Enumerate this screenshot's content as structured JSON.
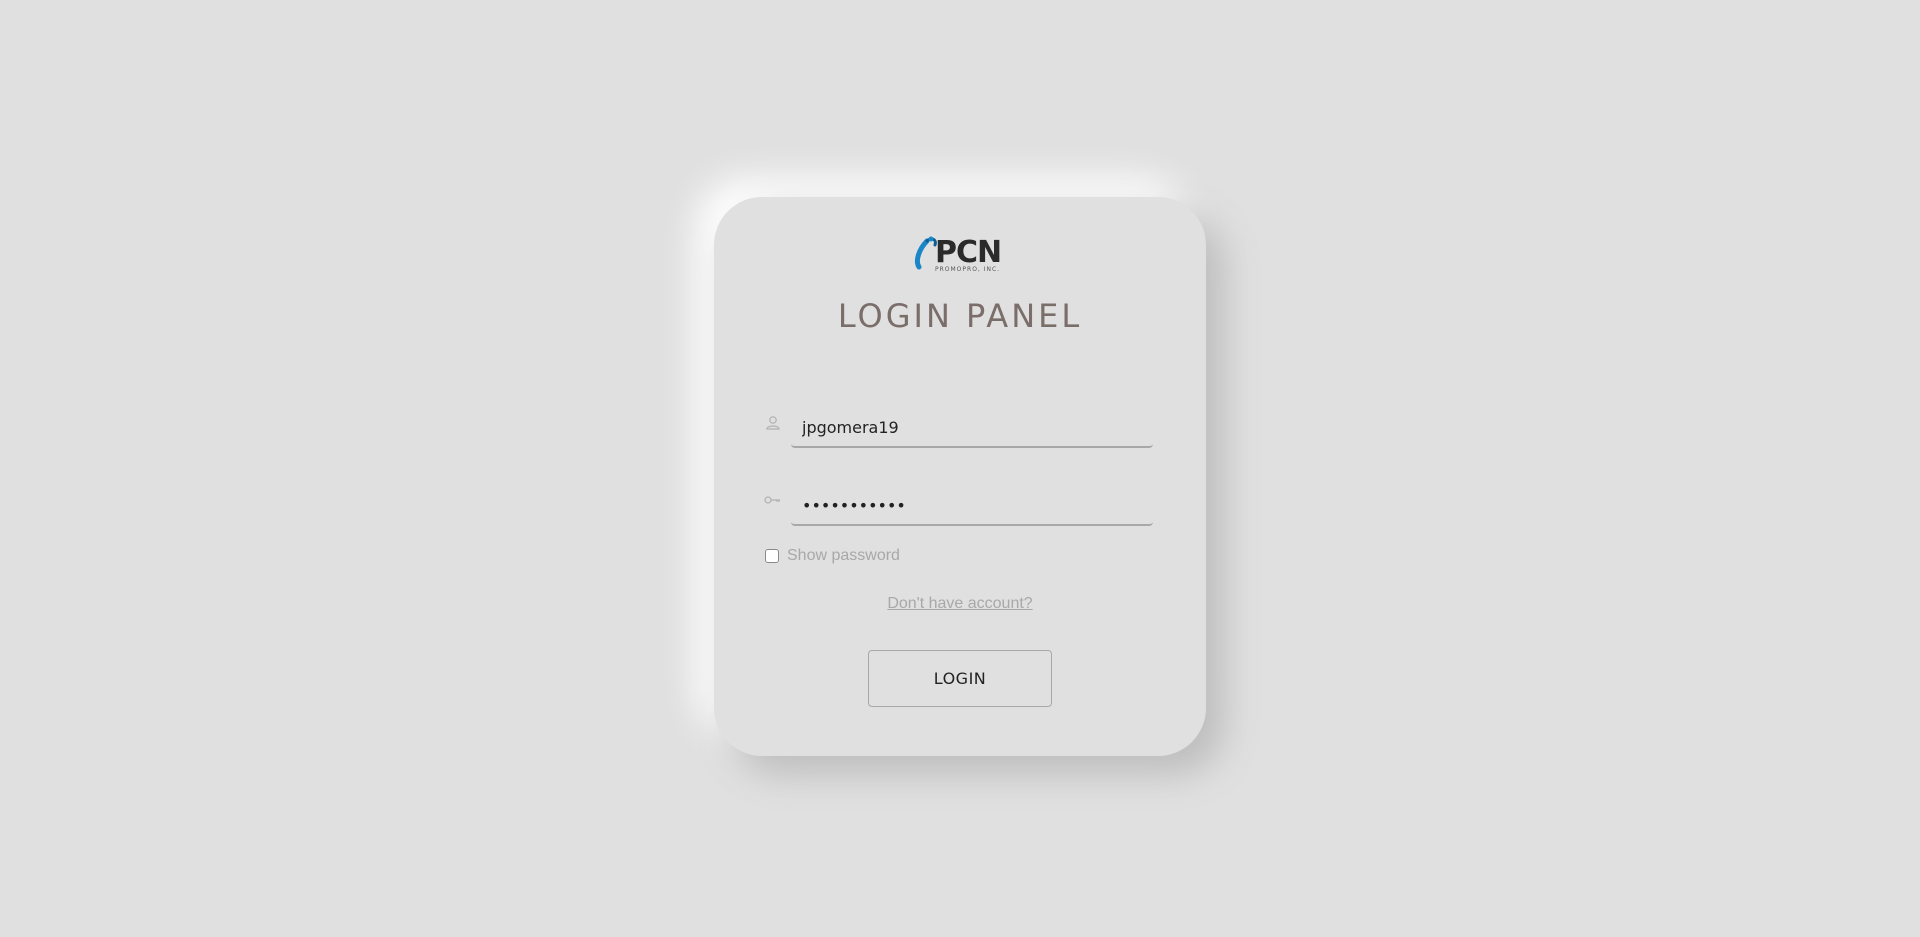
{
  "logo": {
    "wordmark": "PCN",
    "subtext": "PROMOPRO, INC.",
    "accent_color": "#1a86c8"
  },
  "panel": {
    "title": "LOGIN PANEL"
  },
  "username": {
    "icon": "user-icon",
    "value": "jpgomera19"
  },
  "password": {
    "icon": "key-icon",
    "value": "•••••••••••"
  },
  "show_password": {
    "label": "Show password",
    "checked": false
  },
  "account_link": {
    "label": "Don't have account?"
  },
  "login_button": {
    "label": "LOGIN"
  },
  "colors": {
    "background": "#e0e0e0",
    "title": "#7a6e6a",
    "muted": "#a8a8a8"
  }
}
